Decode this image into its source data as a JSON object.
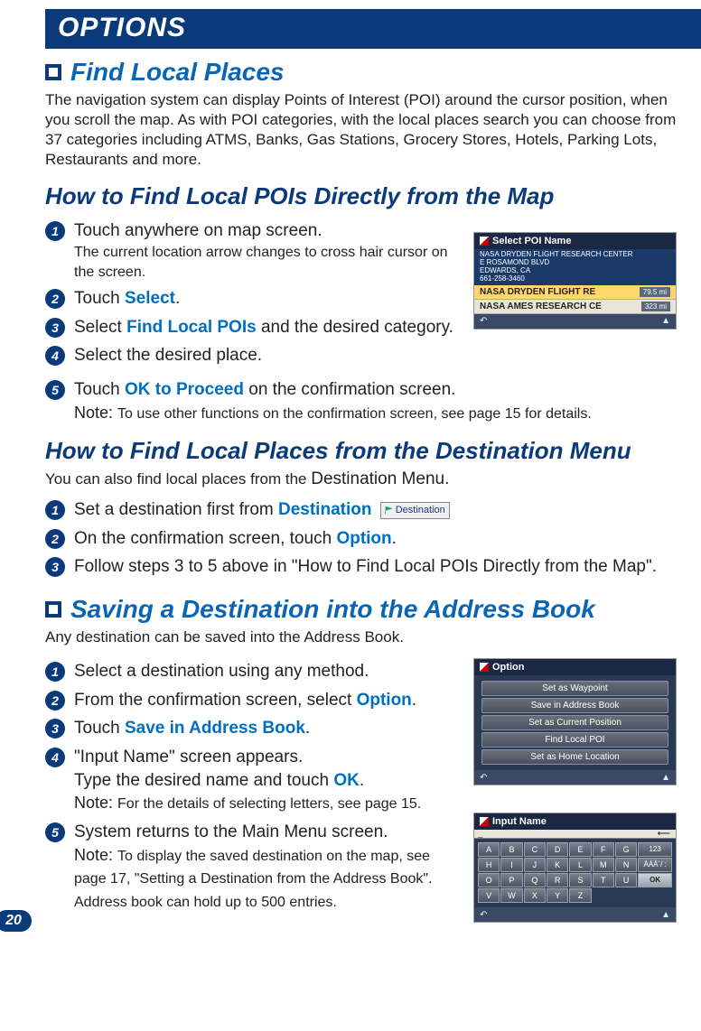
{
  "header": "OPTIONS",
  "page_number": "20",
  "section1": {
    "title": "Find Local Places",
    "intro": "The navigation system can display Points of Interest (POI) around the cursor position, when you scroll the map. As with POI categories, with the local places search you can choose from 37 categories including ATMS, Banks, Gas Stations, Grocery Stores, Hotels, Parking Lots, Restaurants and more."
  },
  "sub1": {
    "heading": "How to Find Local POIs Directly from the Map",
    "steps": {
      "s1_main": "Touch anywhere on map screen.",
      "s1_sub": "The current location arrow changes to cross hair cursor on the screen.",
      "s2_pre": "Touch ",
      "s2_hl": "Select",
      "s2_post": ".",
      "s3_pre": "Select ",
      "s3_hl": "Find Local POIs",
      "s3_post": " and the desired category.",
      "s4": "Select the desired place.",
      "s5_pre": "Touch ",
      "s5_hl": "OK to Proceed",
      "s5_post": " on the confirmation screen.",
      "s5_note_label": "Note: ",
      "s5_note": "To use other functions on the confirmation screen, see page 15 for details."
    }
  },
  "sub2": {
    "heading": "How to Find Local Places from the Destination Menu",
    "intro_pre": "You can also find local places from the ",
    "intro_big": "Destination Menu.",
    "steps": {
      "s1_pre": "Set a destination first from ",
      "s1_hl": "Destination",
      "s2_pre": "On the confirmation screen, touch ",
      "s2_hl": "Option",
      "s2_post": ".",
      "s3": "Follow steps 3 to 5 above in \"How to Find Local POIs Directly from the Map\"."
    }
  },
  "section2": {
    "title": "Saving a Destination into the Address Book",
    "intro": "Any destination can be saved into the Address Book.",
    "steps": {
      "s1": "Select a destination using any method.",
      "s2_pre": "From the confirmation screen, select ",
      "s2_hl": "Option",
      "s2_post": ".",
      "s3_pre": "Touch ",
      "s3_hl": "Save in Address Book",
      "s3_post": ".",
      "s4_line1": "\"Input Name\" screen appears.",
      "s4_line2_pre": "Type the desired name and touch ",
      "s4_line2_hl": "OK",
      "s4_line2_post": ".",
      "s4_note_label": "Note: ",
      "s4_note": "For the details of selecting letters, see page 15.",
      "s5_main": "System returns to the Main Menu screen.",
      "s5_note_label": "Note: ",
      "s5_note": "To display the saved destination on the map, see page 17, \"Setting a Destination from the Address Book\". Address book can hold up to 500 entries."
    }
  },
  "screenshot1": {
    "title": "Select POI Name",
    "sub_line1": "NASA DRYDEN FLIGHT RESEARCH CENTER",
    "sub_line2": "E ROSAMOND BLVD",
    "sub_line3": "EDWARDS, CA",
    "sub_line4": "661-258-3460",
    "row1_name": "NASA DRYDEN FLIGHT RE",
    "row1_dist": "79.5 mi",
    "row2_name": "NASA AMES RESEARCH CE",
    "row2_dist": "323 mi"
  },
  "screenshot2": {
    "title": "Option",
    "items": [
      "Set as Waypoint",
      "Save in Address Book",
      "Set as Current Position",
      "Find Local POI",
      "Set as Home Location"
    ]
  },
  "screenshot3": {
    "title": "Input Name",
    "rows": [
      [
        "A",
        "B",
        "C",
        "D",
        "E",
        "F",
        "G",
        "123"
      ],
      [
        "H",
        "I",
        "J",
        "K",
        "L",
        "M",
        "N",
        "ÀÁÂ´/ :"
      ],
      [
        "O",
        "P",
        "Q",
        "R",
        "S",
        "T",
        "U",
        "OK"
      ],
      [
        "V",
        "W",
        "X",
        "Y",
        "Z",
        "",
        "",
        ""
      ]
    ],
    "back": "⟵"
  },
  "dest_button_label": "Destination"
}
